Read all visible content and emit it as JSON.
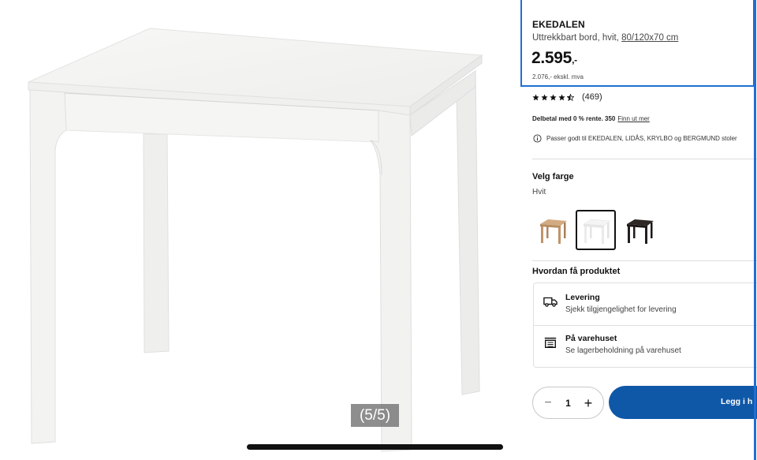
{
  "product": {
    "name": "EKEDALEN",
    "description_prefix": "Uttrekkbart bord, hvit, ",
    "description_dims": "80/120x70 cm",
    "price": "2.595",
    "price_suffix": ",-",
    "price_excl_vat": "2.076,- ekskl. mva",
    "rating_value": 4.5,
    "rating_count": "(469)",
    "installment_text": "Delbetal med 0 % rente. 350",
    "installment_link": "Finn ut mer",
    "fits_text": "Passer godt til EKEDALEN, LIDÅS, KRYLBO og BERGMUND stoler"
  },
  "color": {
    "heading": "Velg farge",
    "selected": "Hvit",
    "options": [
      {
        "name": "bjork",
        "hex": "#c9a27a"
      },
      {
        "name": "hvit",
        "hex": "#f3f3f3"
      },
      {
        "name": "morkebrun",
        "hex": "#2b2523"
      }
    ]
  },
  "fulfillment": {
    "heading": "Hvordan få produktet",
    "options": [
      {
        "title": "Levering",
        "subtitle": "Sjekk tilgjengelighet for levering",
        "icon": "truck-icon"
      },
      {
        "title": "På varehuset",
        "subtitle": "Se lagerbeholdning på varehuset",
        "icon": "store-icon"
      }
    ]
  },
  "cart": {
    "quantity": "1",
    "minus": "−",
    "plus": "+",
    "add_label": "Legg i h"
  },
  "overlay": {
    "page_indicator": "(5/5)"
  },
  "theme": {
    "accent": "#0f58a8",
    "highlight": "#1f6fd1"
  }
}
